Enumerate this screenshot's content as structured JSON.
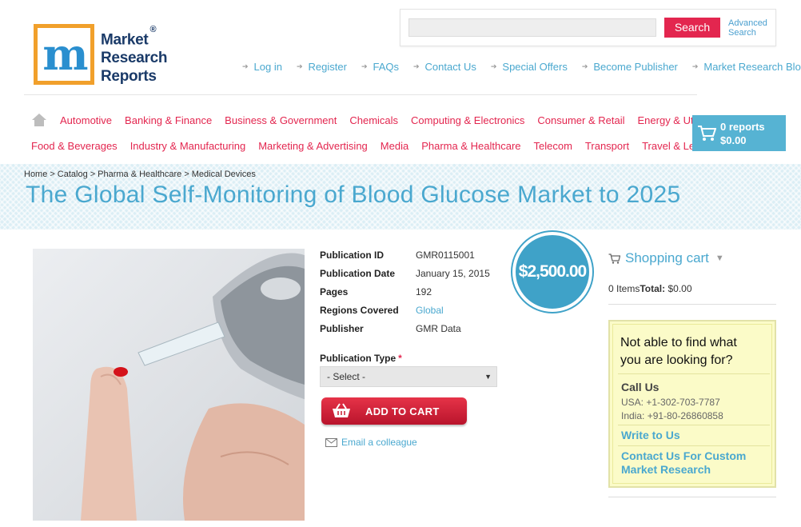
{
  "logo": {
    "mark": "m",
    "line1": "Market",
    "line2": "Research",
    "line3": "Reports",
    "registered": "®"
  },
  "search": {
    "button": "Search",
    "advanced_line1": "Advanced",
    "advanced_line2": "Search"
  },
  "top_links": [
    "Log in",
    "Register",
    "FAQs",
    "Contact Us",
    "Special Offers",
    "Become Publisher",
    "Market Research Blog"
  ],
  "categories_row1": [
    "Automotive",
    "Banking & Finance",
    "Business & Government",
    "Chemicals",
    "Computing & Electronics",
    "Consumer & Retail",
    "Energy & Utilities"
  ],
  "categories_row2": [
    "Food & Beverages",
    "Industry & Manufacturing",
    "Marketing & Advertising",
    "Media",
    "Pharma & Healthcare",
    "Telecom",
    "Transport",
    "Travel & Leisure"
  ],
  "cart_box": {
    "reports": "0 reports",
    "amount": "$0.00"
  },
  "breadcrumb": [
    "Home",
    "Catalog",
    "Pharma & Healthcare",
    "Medical Devices"
  ],
  "breadcrumb_sep": ">",
  "page_title": "The Global Self-Monitoring of Blood Glucose Market to 2025",
  "details": [
    {
      "label": "Publication ID",
      "value": "GMR0115001"
    },
    {
      "label": "Publication Date",
      "value": "January 15, 2015"
    },
    {
      "label": "Pages",
      "value": "192"
    },
    {
      "label": "Regions Covered",
      "value": "Global"
    },
    {
      "label": "Publisher",
      "value": "GMR Data"
    }
  ],
  "price": "$2,500.00",
  "publication_type": {
    "label": "Publication Type",
    "required": "*",
    "selected": "- Select -"
  },
  "add_to_cart": "ADD TO CART",
  "email_colleague": "Email a colleague",
  "sidebar": {
    "cart_title": "Shopping cart",
    "items_text": "0 Items",
    "total_label": "Total:",
    "total_value": "$0.00",
    "help_line1": "Not able to find what",
    "help_line2": "you are looking for?",
    "call_us": "Call Us",
    "phone_usa": "USA: +1-302-703-7787",
    "phone_india": "India: +91-80-26860858",
    "write_to_us": "Write to Us",
    "custom_line1": "Contact Us For Custom",
    "custom_line2": "Market Research"
  },
  "colors": {
    "accent_blue": "#4aa8cf",
    "accent_red": "#e3264f",
    "cart_blue": "#56b3d3"
  }
}
